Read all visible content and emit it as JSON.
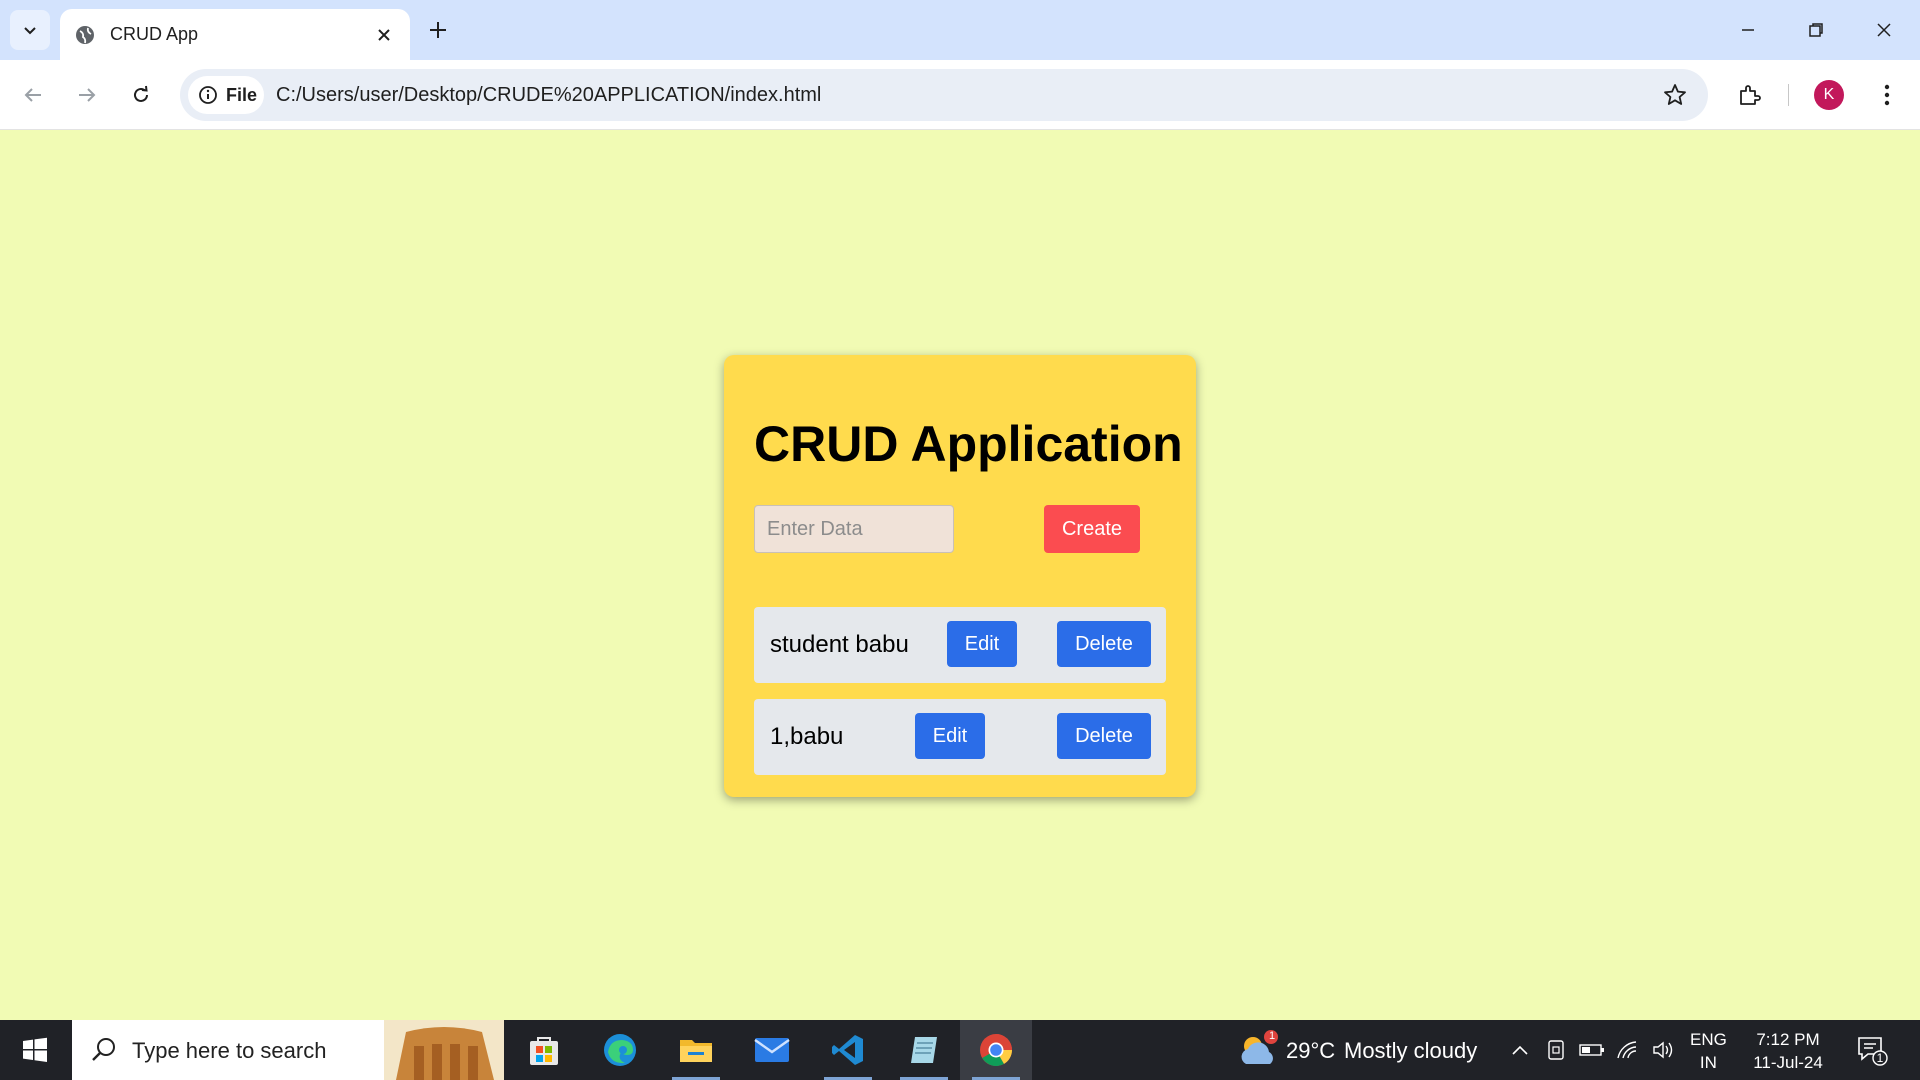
{
  "browser": {
    "tab_title": "CRUD App",
    "chip_label": "File",
    "url": "C:/Users/user/Desktop/CRUDE%20APPLICATION/index.html",
    "profile_initial": "K"
  },
  "app": {
    "title": "CRUD Application",
    "input_placeholder": "Enter Data",
    "input_value": "",
    "create_label": "Create",
    "items": [
      {
        "text": "student babu",
        "edit_label": "Edit",
        "delete_label": "Delete"
      },
      {
        "text": "1,babu",
        "edit_label": "Edit",
        "delete_label": "Delete"
      }
    ],
    "colors": {
      "page_bg": "#f1fbb4",
      "card_bg": "#ffdb4d",
      "create_btn": "#fb4c50",
      "action_btn": "#2b6de8",
      "item_bg": "#e5e8ec"
    }
  },
  "taskbar": {
    "search_placeholder": "Type here to search",
    "weather_temp": "29°C",
    "weather_desc": "Mostly cloudy",
    "weather_badge": "1",
    "language_1": "ENG",
    "language_2": "IN",
    "time": "7:12 PM",
    "date": "11-Jul-24",
    "notification_count": "1",
    "apps": [
      "store-icon",
      "edge-icon",
      "file-explorer-icon",
      "mail-icon",
      "vscode-icon",
      "notepad-icon",
      "chrome-icon"
    ]
  }
}
